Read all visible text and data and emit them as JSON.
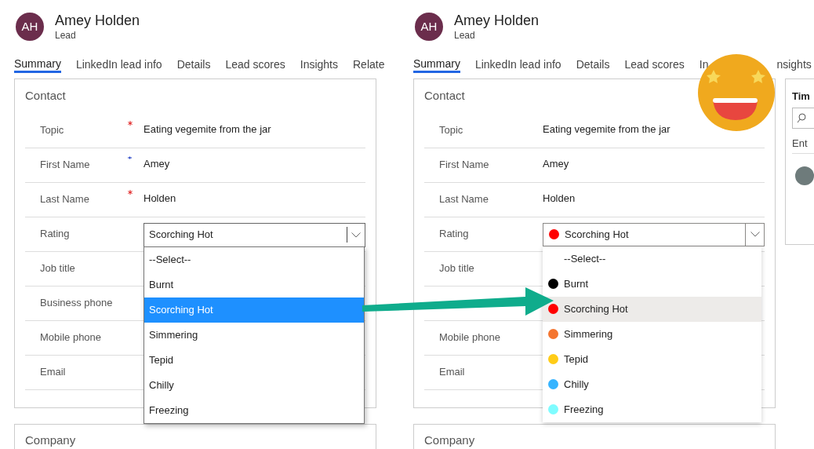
{
  "panels": [
    {
      "kind": "classic",
      "avatar": "AH",
      "name": "Amey Holden",
      "entity": "Lead",
      "tabs": [
        {
          "label": "Summary",
          "selected": true
        },
        {
          "label": "LinkedIn lead info",
          "selected": false
        },
        {
          "label": "Details",
          "selected": false
        },
        {
          "label": "Lead scores",
          "selected": false
        },
        {
          "label": "Insights",
          "selected": false
        },
        {
          "label": "Relate",
          "selected": false
        }
      ],
      "section": "Contact",
      "fields": [
        {
          "kind": "text",
          "label": "Topic",
          "required": true,
          "recommended": false,
          "value": "Eating vegemite from the jar"
        },
        {
          "kind": "text",
          "label": "First Name",
          "required": false,
          "recommended": true,
          "value": "Amey"
        },
        {
          "kind": "text",
          "label": "Last Name",
          "required": true,
          "recommended": false,
          "value": "Holden"
        },
        {
          "kind": "choice",
          "label": "Rating",
          "required": false,
          "recommended": false,
          "value": "Scorching Hot",
          "expanded": true,
          "options": [
            {
              "label": "--Select--",
              "selected": false
            },
            {
              "label": "Burnt",
              "selected": false
            },
            {
              "label": "Scorching Hot",
              "selected": true
            },
            {
              "label": "Simmering",
              "selected": false
            },
            {
              "label": "Tepid",
              "selected": false
            },
            {
              "label": "Chilly",
              "selected": false
            },
            {
              "label": "Freezing",
              "selected": false
            }
          ]
        },
        {
          "kind": "text",
          "label": "Job title",
          "required": false,
          "recommended": false
        },
        {
          "kind": "text",
          "label": "Business phone",
          "required": false,
          "recommended": false
        },
        {
          "kind": "text",
          "label": "Mobile phone",
          "required": false,
          "recommended": false
        },
        {
          "kind": "text",
          "label": "Email",
          "required": false,
          "recommended": false
        }
      ],
      "next_section": "Company"
    },
    {
      "kind": "colored",
      "avatar": "AH",
      "name": "Amey Holden",
      "entity": "Lead",
      "tabs": [
        {
          "label": "Summary",
          "selected": true
        },
        {
          "label": "LinkedIn lead info",
          "selected": false
        },
        {
          "label": "Details",
          "selected": false
        },
        {
          "label": "Lead scores",
          "selected": false
        },
        {
          "label": "In",
          "selected": false
        },
        {
          "label": "nsights",
          "selected": false
        }
      ],
      "section": "Contact",
      "fields": [
        {
          "kind": "text",
          "label": "Topic",
          "value": "Eating vegemite from the jar"
        },
        {
          "kind": "text",
          "label": "First Name",
          "value": "Amey"
        },
        {
          "kind": "text",
          "label": "Last Name",
          "value": "Holden"
        },
        {
          "kind": "choice",
          "label": "Rating",
          "value": "Scorching Hot",
          "color": "#ff0000",
          "expanded": true,
          "options": [
            {
              "label": "--Select--",
              "selected": false
            },
            {
              "label": "Burnt",
              "selected": false,
              "color": "#000000"
            },
            {
              "label": "Scorching Hot",
              "selected": true,
              "color": "#ff0000"
            },
            {
              "label": "Simmering",
              "selected": false,
              "color": "#f47530"
            },
            {
              "label": "Tepid",
              "selected": false,
              "color": "#ffcc17"
            },
            {
              "label": "Chilly",
              "selected": false,
              "color": "#36b4ff"
            },
            {
              "label": "Freezing",
              "selected": false,
              "color": "#7ffcff"
            }
          ]
        },
        {
          "kind": "text",
          "label": "Job title"
        },
        {
          "kind": "text"
        },
        {
          "kind": "text",
          "label": "Mobile phone"
        },
        {
          "kind": "text",
          "label": "Email"
        }
      ],
      "next_section": "Company",
      "side_panel": {
        "title": "Tim",
        "filter": "Ent"
      }
    }
  ]
}
